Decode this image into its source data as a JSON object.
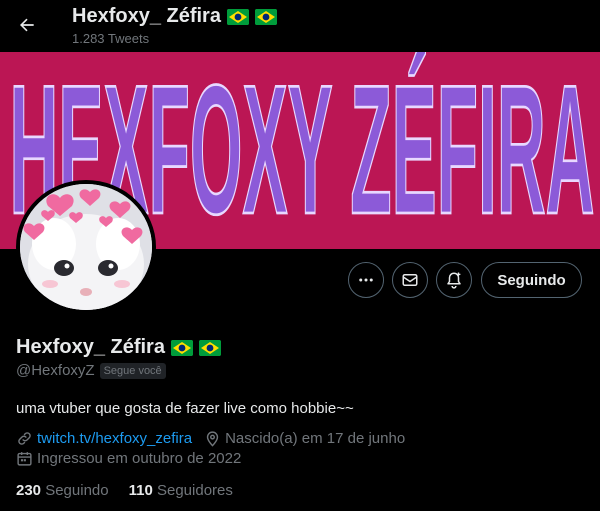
{
  "header": {
    "name": "Hexfoxy_ Zéfira",
    "tweet_count": "1.283 Tweets"
  },
  "banner": {
    "text": "HEXFOXY ZÉFIRA",
    "bg_color": "#bb1654",
    "text_color": "#8c5ad8"
  },
  "actions": {
    "follow_label": "Seguindo"
  },
  "profile": {
    "display_name": "Hexfoxy_ Zéfira",
    "handle": "@HexfoxyZ",
    "follows_you_badge": "Segue você",
    "bio": "uma vtuber que gosta de fazer live como hobbie~~",
    "link": "twitch.tv/hexfoxy_zefira",
    "birthday": "Nascido(a) em 17 de junho",
    "joined": "Ingressou em outubro de 2022"
  },
  "stats": {
    "following_count": "230",
    "following_label": "Seguindo",
    "followers_count": "110",
    "followers_label": "Seguidores"
  },
  "icons": [
    "arrow-left-icon",
    "flag-brazil-icon",
    "more-icon",
    "mail-icon",
    "bell-plus-icon",
    "link-icon",
    "location-icon",
    "calendar-icon"
  ]
}
